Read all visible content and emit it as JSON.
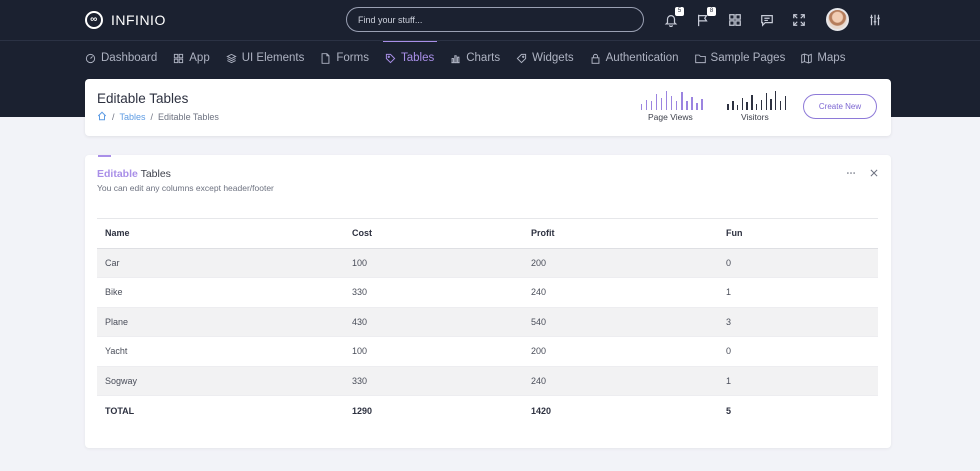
{
  "brand": {
    "name": "INFINIO",
    "mark": "∞"
  },
  "search": {
    "placeholder": "Find your stuff..."
  },
  "topbar": {
    "notifications_count": "5",
    "flags_count": "8"
  },
  "nav": [
    {
      "label": "Dashboard",
      "icon": "dashboard-icon"
    },
    {
      "label": "App",
      "icon": "grid-icon"
    },
    {
      "label": "UI Elements",
      "icon": "layers-icon"
    },
    {
      "label": "Forms",
      "icon": "file-icon"
    },
    {
      "label": "Tables",
      "icon": "tag-icon",
      "active": true
    },
    {
      "label": "Charts",
      "icon": "bar-chart-icon"
    },
    {
      "label": "Widgets",
      "icon": "tag-outline-icon"
    },
    {
      "label": "Authentication",
      "icon": "lock-icon"
    },
    {
      "label": "Sample Pages",
      "icon": "folder-icon"
    },
    {
      "label": "Maps",
      "icon": "map-icon"
    }
  ],
  "header": {
    "title": "Editable Tables",
    "breadcrumb": [
      "Tables",
      "Editable Tables"
    ],
    "page_views_label": "Page Views",
    "visitors_label": "Visitors",
    "create_label": "Create New"
  },
  "sparklines": {
    "page_views": [
      0.3,
      0.55,
      0.45,
      0.85,
      0.65,
      1.0,
      0.75,
      0.5,
      0.95,
      0.45,
      0.7,
      0.35,
      0.6
    ],
    "visitors": [
      0.3,
      0.5,
      0.25,
      0.65,
      0.4,
      0.8,
      0.3,
      0.55,
      0.9,
      0.6,
      1.0,
      0.45,
      0.75
    ],
    "page_views_color": "#9b84e0",
    "visitors_color": "#2d3140"
  },
  "card": {
    "title_bold": "Editable",
    "title_rest": " Tables",
    "subtitle": "You can edit any columns except header/footer"
  },
  "table": {
    "headers": [
      "Name",
      "Cost",
      "Profit",
      "Fun"
    ],
    "rows": [
      [
        "Car",
        "100",
        "200",
        "0"
      ],
      [
        "Bike",
        "330",
        "240",
        "1"
      ],
      [
        "Plane",
        "430",
        "540",
        "3"
      ],
      [
        "Yacht",
        "100",
        "200",
        "0"
      ],
      [
        "Sogway",
        "330",
        "240",
        "1"
      ]
    ],
    "footer": [
      "TOTAL",
      "1290",
      "1420",
      "5"
    ]
  },
  "colors": {
    "accent": "#a98fe8",
    "link": "#5d9be3",
    "topbar": "#1b2130"
  }
}
